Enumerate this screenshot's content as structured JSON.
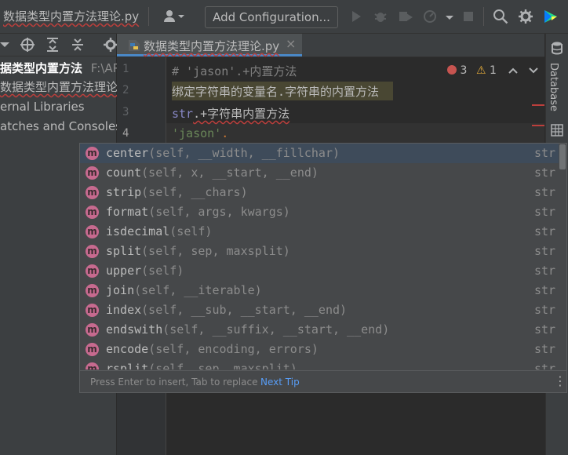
{
  "window": {
    "file_title": "数据类型内置方法理论.py"
  },
  "toolbar": {
    "run_config_label": "Add Configuration...",
    "icons": [
      "user-icon",
      "run-icon",
      "debug-icon",
      "coverage-icon",
      "profile-icon",
      "stop-icon",
      "search-icon",
      "settings-icon",
      "jetbrains-icon"
    ]
  },
  "project_tree": {
    "root_label": "据类型内置方法",
    "root_path": "F:\\APP",
    "file_label": "数据类型内置方法理论",
    "external_libraries": "ernal Libraries",
    "scratches": "atches and Consoles"
  },
  "editor": {
    "tab_label": "数据类型内置方法理论.py",
    "lines": [
      {
        "number": "1",
        "comment": "# 'jason'.+内置方法"
      },
      {
        "number": "2",
        "text": "绑定字符串的变量名.字符串的内置方法"
      },
      {
        "number": "3",
        "kw": "str",
        "rest": ".+字符串内置方法"
      },
      {
        "number": "4",
        "str": "'jason'",
        "rest": "."
      }
    ],
    "inspections": {
      "errors": "3",
      "warnings": "1"
    }
  },
  "right_strip": {
    "database_label": "Database"
  },
  "completion": {
    "items": [
      {
        "name": "center",
        "params": "(self, __width, __fillchar)",
        "type": "str",
        "selected": true
      },
      {
        "name": "count",
        "params": "(self, x, __start, __end)",
        "type": "str"
      },
      {
        "name": "strip",
        "params": "(self, __chars)",
        "type": "str"
      },
      {
        "name": "format",
        "params": "(self, args, kwargs)",
        "type": "str"
      },
      {
        "name": "isdecimal",
        "params": "(self)",
        "type": "str"
      },
      {
        "name": "split",
        "params": "(self, sep, maxsplit)",
        "type": "str"
      },
      {
        "name": "upper",
        "params": "(self)",
        "type": "str"
      },
      {
        "name": "join",
        "params": "(self, __iterable)",
        "type": "str"
      },
      {
        "name": "index",
        "params": "(self, __sub, __start, __end)",
        "type": "str"
      },
      {
        "name": "endswith",
        "params": "(self, __suffix, __start, __end)",
        "type": "str"
      },
      {
        "name": "encode",
        "params": "(self, encoding, errors)",
        "type": "str"
      },
      {
        "name": "rsplit",
        "params": "(self, sep, maxsplit)",
        "type": "str"
      }
    ],
    "icon_letter": "m",
    "hint": "Press Enter to insert, Tab to replace",
    "next_tip": "Next Tip"
  },
  "colors": {
    "accent": "#4a88c7",
    "error": "#bc3f3c",
    "method_icon": "#c76a8f"
  }
}
